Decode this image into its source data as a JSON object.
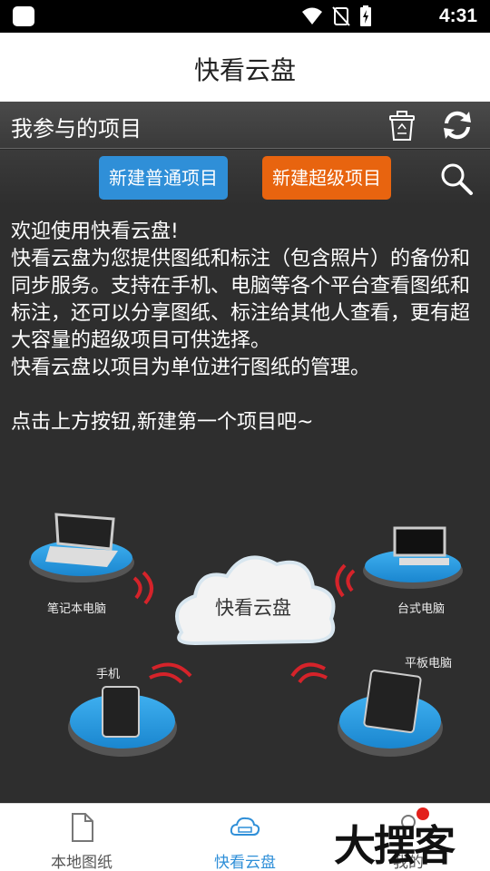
{
  "statusbar": {
    "time": "4:31"
  },
  "appbar": {
    "title": "快看云盘"
  },
  "project_header": {
    "title": "我参与的项目"
  },
  "actions": {
    "new_normal_label": "新建普通项目",
    "new_super_label": "新建超级项目"
  },
  "intro": {
    "line1": "欢迎使用快看云盘!",
    "paragraph": "快看云盘为您提供图纸和标注（包含照片）的备份和同步服务。支持在手机、电脑等各个平台查看图纸和标注，还可以分享图纸、标注给其他人查看，更有超大容量的超级项目可供选择。",
    "line3": "快看云盘以项目为单位进行图纸的管理。",
    "line4": "点击上方按钮,新建第一个项目吧~"
  },
  "diagram": {
    "center": "快看云盘",
    "laptop": "笔记本电脑",
    "desktop": "台式电脑",
    "phone": "手机",
    "tablet": "平板电脑"
  },
  "nav": {
    "items": [
      {
        "label": "本地图纸",
        "icon": "document-icon"
      },
      {
        "label": "快看云盘",
        "icon": "cloud-icon"
      },
      {
        "label": "我的",
        "icon": "profile-icon"
      }
    ]
  },
  "watermark": {
    "text": "大摆客"
  },
  "colors": {
    "primary_blue": "#2f8fd8",
    "orange": "#e8640f",
    "badge_red": "#e3201b"
  }
}
